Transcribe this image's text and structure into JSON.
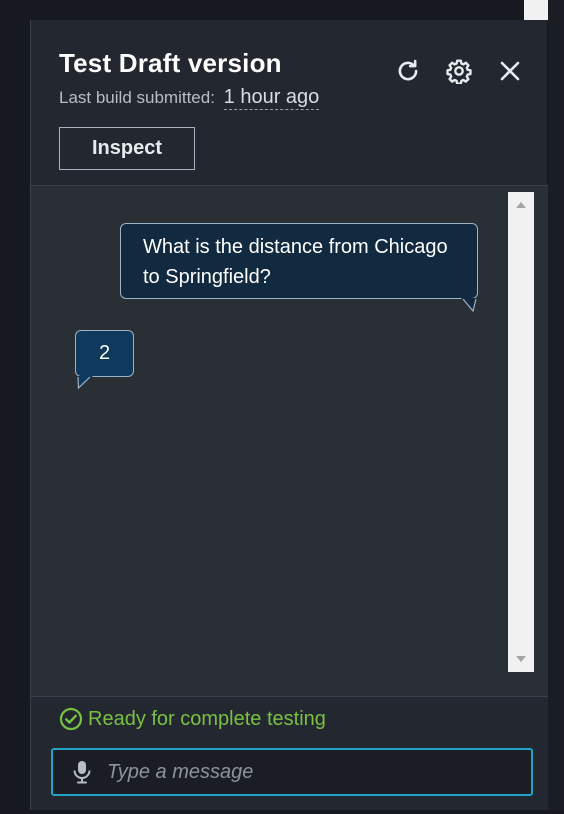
{
  "panel": {
    "title": "Test Draft version",
    "subtitle_label": "Last build submitted:",
    "subtitle_value": "1 hour ago",
    "inspect_label": "Inspect",
    "icons": [
      "refresh-icon",
      "settings-icon",
      "close-icon"
    ]
  },
  "conversation": {
    "messages": [
      {
        "role": "user",
        "text": "What is the distance from Chicago to Springfield?"
      },
      {
        "role": "bot",
        "text": "2"
      }
    ]
  },
  "footer": {
    "status_text": "Ready for complete testing",
    "status_color": "#7ac043",
    "input_placeholder": "Type a message",
    "input_value": ""
  },
  "colors": {
    "panel_bg": "#232830",
    "chat_bg": "#2a2e35",
    "user_bubble": "#112a3f",
    "bot_bubble": "#0f3a5e",
    "focus_border": "#1fa5c8"
  }
}
